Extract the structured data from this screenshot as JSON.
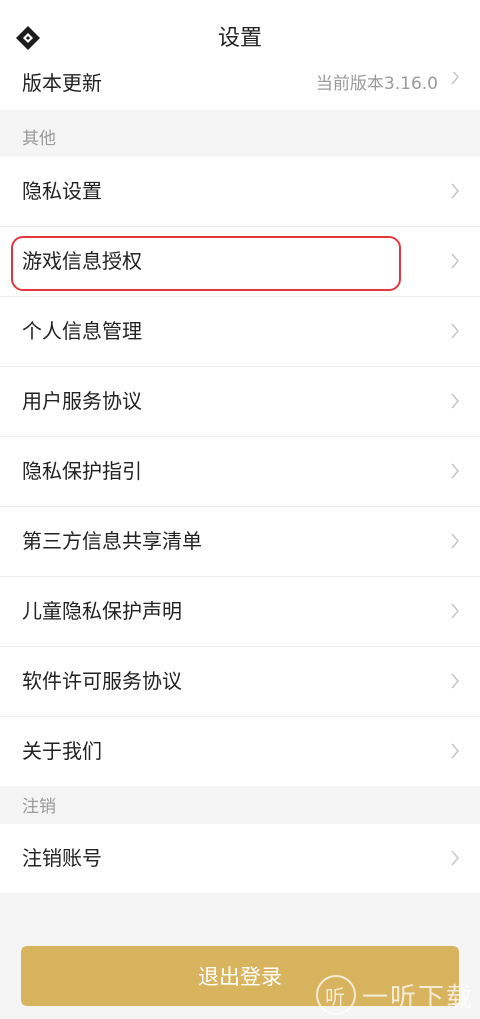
{
  "header": {
    "title": "设置",
    "back_icon": "diamond-logo-back-icon"
  },
  "version_row": {
    "label": "版本更新",
    "value": "当前版本3.16.0"
  },
  "sections": {
    "other": {
      "title": "其他",
      "items": [
        {
          "label": "隐私设置"
        },
        {
          "label": "游戏信息授权"
        },
        {
          "label": "个人信息管理"
        },
        {
          "label": "用户服务协议"
        },
        {
          "label": "隐私保护指引"
        },
        {
          "label": "第三方信息共享清单"
        },
        {
          "label": "儿童隐私保护声明"
        },
        {
          "label": "软件许可服务协议"
        },
        {
          "label": "关于我们"
        }
      ]
    },
    "cancel": {
      "title": "注销",
      "items": [
        {
          "label": "注销账号"
        }
      ]
    }
  },
  "logout_button": {
    "label": "退出登录"
  },
  "watermark": {
    "text": "一听下载",
    "icon_glyph": "听"
  },
  "colors": {
    "accent": "#d8b45f",
    "highlight": "#e0383e",
    "muted_text": "#9a9a9a"
  }
}
